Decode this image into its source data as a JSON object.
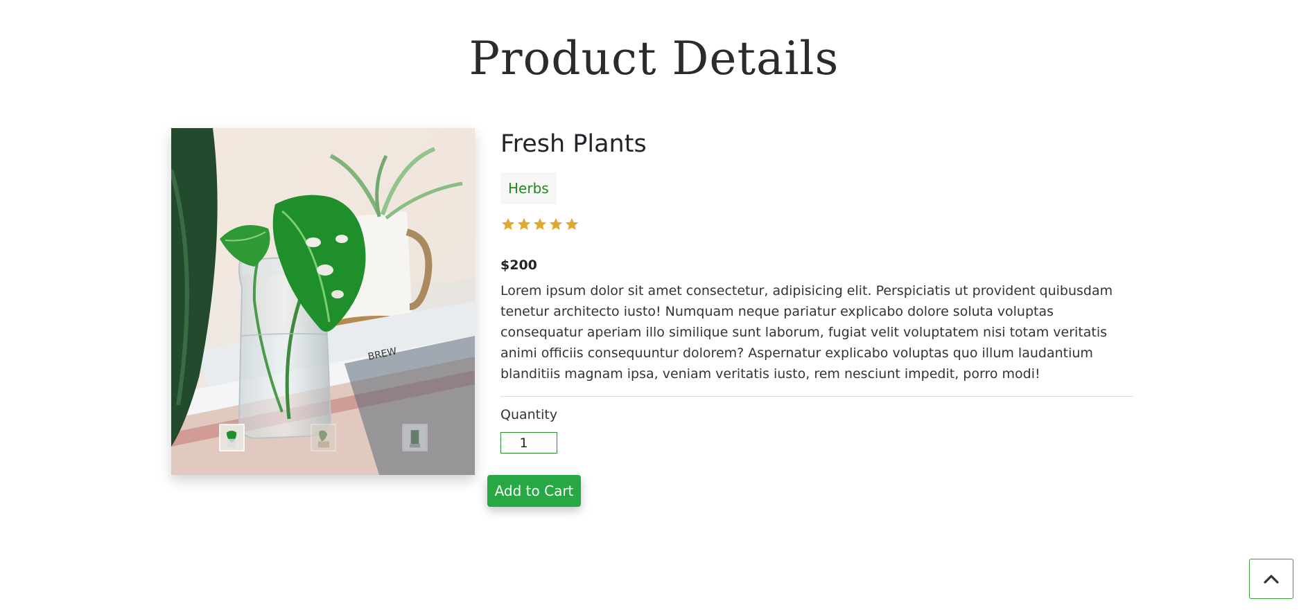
{
  "page": {
    "title": "Product Details"
  },
  "product": {
    "name": "Fresh Plants",
    "category": "Herbs",
    "rating": 5,
    "rating_max": 5,
    "price": "$200",
    "description": "Lorem ipsum dolor sit amet consectetur, adipisicing elit. Perspiciatis ut provident quibusdam tenetur architecto iusto! Numquam neque pariatur explicabo dolore soluta voluptas consequatur aperiam illo similique sunt laborum, fugiat velit voluptatem nisi totam veritatis animi officiis consequuntur dolorem? Aspernatur explicabo voluptas quo illum laudantium blanditiis magnam ipsa, veniam veritatis iusto, rem nesciunt impedit, porro modi!",
    "quantity_label": "Quantity",
    "quantity_value": "1",
    "add_to_cart_label": "Add to Cart"
  },
  "gallery": {
    "main_image": "monstera-plant-in-glass-jar-photo",
    "thumbnails": [
      {
        "name": "thumbnail-1",
        "active": true
      },
      {
        "name": "thumbnail-2",
        "active": false
      },
      {
        "name": "thumbnail-3",
        "active": false
      }
    ]
  },
  "icons": {
    "star": "star-icon",
    "back_to_top": "chevron-up-icon"
  },
  "colors": {
    "accent_green": "#28a745",
    "category_text": "#1e8a1e",
    "star_gold": "#e0a82e"
  }
}
